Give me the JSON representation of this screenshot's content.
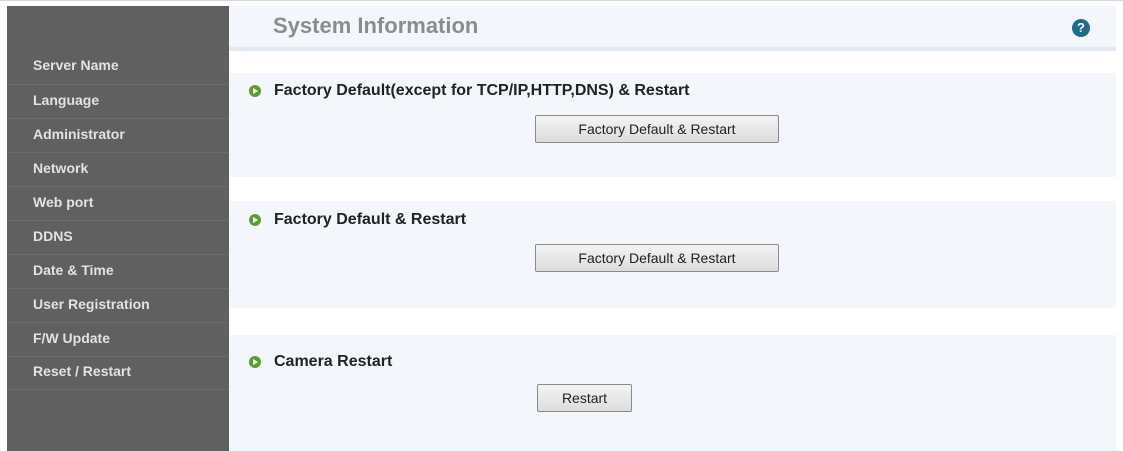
{
  "sidebar": {
    "items": [
      {
        "label": "Server Name"
      },
      {
        "label": "Language"
      },
      {
        "label": "Administrator"
      },
      {
        "label": "Network"
      },
      {
        "label": "Web port"
      },
      {
        "label": "DDNS"
      },
      {
        "label": "Date & Time"
      },
      {
        "label": "User Registration"
      },
      {
        "label": "F/W Update"
      },
      {
        "label": "Reset / Restart"
      }
    ]
  },
  "header": {
    "title": "System Information",
    "help_icon": "question-circle-icon",
    "help_glyph": "?"
  },
  "sections": [
    {
      "title": "Factory Default(except for TCP/IP,HTTP,DNS) & Restart",
      "button": "Factory Default & Restart"
    },
    {
      "title": "Factory Default & Restart",
      "button": "Factory Default & Restart"
    },
    {
      "title": "Camera Restart",
      "button": "Restart"
    }
  ],
  "colors": {
    "sidebar_bg": "#606060",
    "sidebar_text": "#e2e2e2",
    "section_bg": "#f3f7fb",
    "bullet": "#5aa02c",
    "help_icon": "#1e6e88",
    "title_text": "#8c8c8c"
  }
}
